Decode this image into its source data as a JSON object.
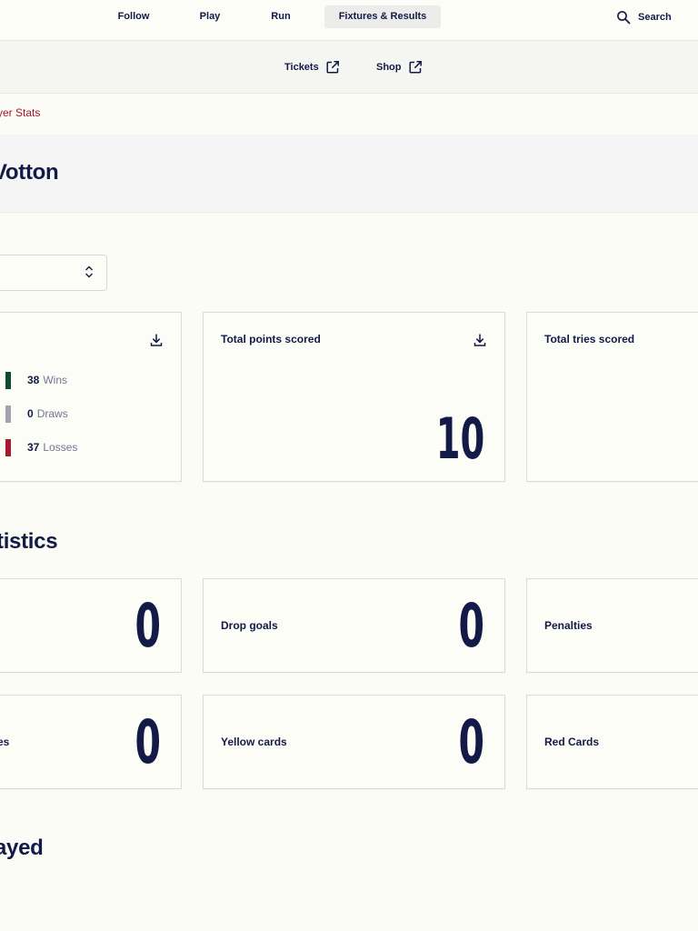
{
  "nav": {
    "items": [
      {
        "label": "Follow"
      },
      {
        "label": "Play"
      },
      {
        "label": "Run"
      },
      {
        "label": "Fixtures & Results",
        "active": true
      }
    ],
    "search_label": "Search",
    "search_icon": "search-icon"
  },
  "subnav": {
    "items": [
      {
        "label": "Tickets",
        "icon": "external-link-icon"
      },
      {
        "label": "Shop",
        "icon": "external-link-icon"
      }
    ]
  },
  "breadcrumb": {
    "label": "yer Stats"
  },
  "player": {
    "name": "Votton"
  },
  "filter": {
    "icon": "chevron-up-down-icon"
  },
  "summary_cards": {
    "results": {
      "download_icon": "download-icon",
      "rows": [
        {
          "value": "38",
          "label": "Wins",
          "color": "#0d4c2c"
        },
        {
          "value": "0",
          "label": "Draws",
          "color": "#a2a3ae"
        },
        {
          "value": "37",
          "label": "Losses",
          "color": "#a61b32"
        }
      ]
    },
    "points": {
      "title": "Total points scored",
      "value": "10",
      "download_icon": "download-icon"
    },
    "tries": {
      "title": "Total tries scored"
    }
  },
  "statistics": {
    "title": "tistics",
    "cards": [
      {
        "title": "",
        "value": "0"
      },
      {
        "title": "Drop goals",
        "value": "0"
      },
      {
        "title": "Penalties",
        "value": ""
      },
      {
        "title": "nces",
        "value": "0"
      },
      {
        "title": "Yellow cards",
        "value": "0"
      },
      {
        "title": "Red Cards",
        "value": ""
      }
    ]
  },
  "played": {
    "title": "ayed"
  },
  "colors": {
    "brand_navy": "#131a47",
    "accent_red": "#a3162f",
    "background": "#fcfcf7"
  }
}
